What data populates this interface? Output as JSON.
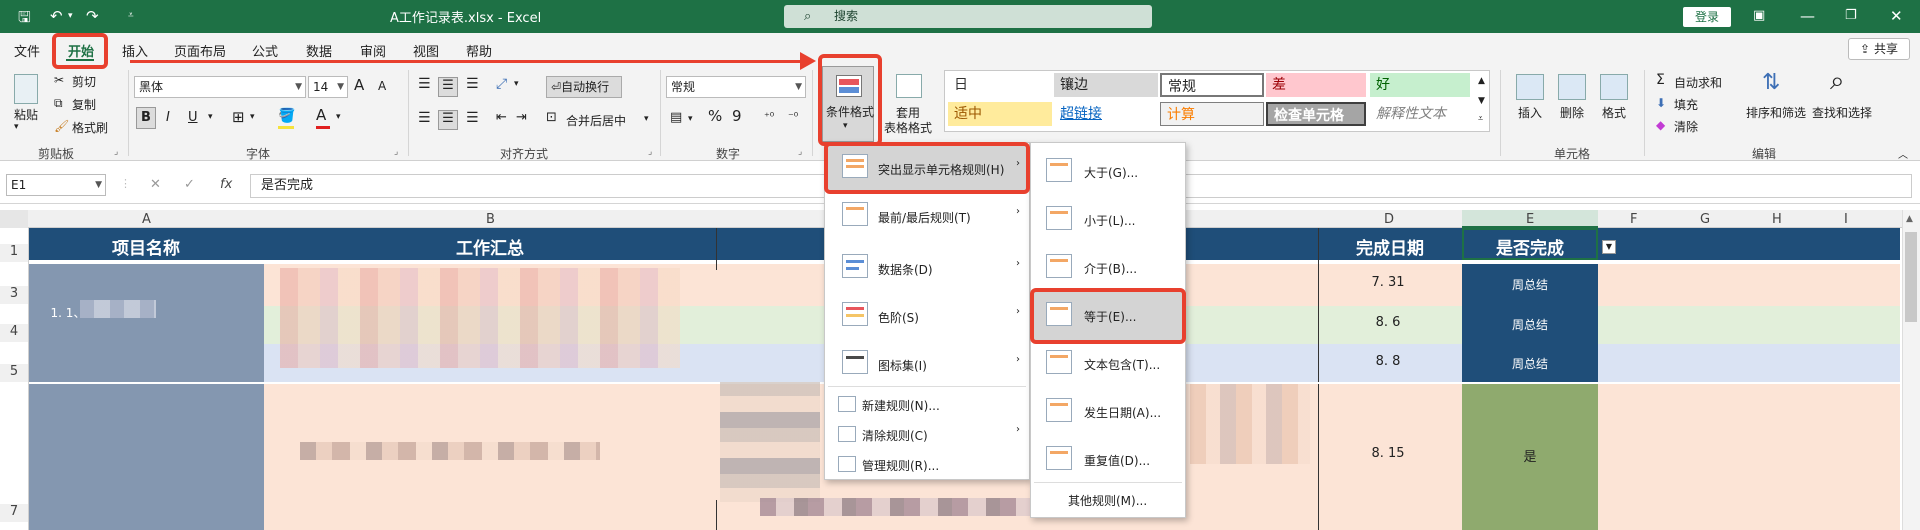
{
  "window": {
    "title": "A工作记录表.xlsx  -  Excel",
    "search_placeholder": "搜索",
    "login": "登录",
    "share": "共享"
  },
  "menu_tabs": [
    "文件",
    "开始",
    "插入",
    "页面布局",
    "公式",
    "数据",
    "审阅",
    "视图",
    "帮助"
  ],
  "clipboard": {
    "paste": "粘贴",
    "cut": "剪切",
    "copy": "复制",
    "format_painter": "格式刷",
    "label": "剪贴板"
  },
  "font": {
    "name": "黑体",
    "size": "14",
    "grow": "A",
    "shrink": "A",
    "bold": "B",
    "italic": "I",
    "underline": "U",
    "font_color": "A",
    "label": "字体"
  },
  "alignment": {
    "wrap": "自动换行",
    "merge": "合并后居中",
    "label": "对齐方式"
  },
  "number": {
    "format": "常规",
    "percent": "%",
    "comma": "9",
    "label": "数字"
  },
  "styles": {
    "cond_format": "条件格式",
    "table_format_1": "套用",
    "table_format_2": "表格格式",
    "cells": [
      "日",
      "镶边",
      "常规",
      "差",
      "好",
      "适中",
      "超链接",
      "计算",
      "检查单元格",
      "解释性文本"
    ]
  },
  "cells_group": {
    "insert": "插入",
    "delete": "删除",
    "format": "格式",
    "label": "单元格"
  },
  "editing": {
    "autosum": "自动求和",
    "fill": "填充",
    "clear": "清除",
    "sort": "排序和筛选",
    "find": "查找和选择",
    "label": "编辑"
  },
  "formula_bar": {
    "name_box": "E1",
    "cancel": "✕",
    "enter": "✓",
    "fx": "fx",
    "value": "是否完成"
  },
  "columns": [
    "A",
    "B",
    "D",
    "E",
    "F",
    "G",
    "H",
    "I"
  ],
  "rows": [
    "1",
    "3",
    "4",
    "5",
    "7"
  ],
  "headers": {
    "a": "项目名称",
    "b": "工作汇总",
    "d": "完成日期",
    "e": "是否完成"
  },
  "cells": {
    "a3": "1. 1、",
    "d3": "7. 31",
    "d4": "8. 6",
    "d5": "8. 8",
    "d6": "8. 15",
    "e3": "周总结",
    "e4": "周总结",
    "e5": "周总结",
    "e6": "是"
  },
  "cf_menu": [
    {
      "label": "突出显示单元格规则(H)"
    },
    {
      "label": "最前/最后规则(T)"
    },
    {
      "label": "数据条(D)"
    },
    {
      "label": "色阶(S)"
    },
    {
      "label": "图标集(I)"
    },
    {
      "label": "新建规则(N)..."
    },
    {
      "label": "清除规则(C)"
    },
    {
      "label": "管理规则(R)..."
    }
  ],
  "sub_menu": [
    {
      "label": "大于(G)..."
    },
    {
      "label": "小于(L)..."
    },
    {
      "label": "介于(B)..."
    },
    {
      "label": "等于(E)..."
    },
    {
      "label": "文本包含(T)..."
    },
    {
      "label": "发生日期(A)..."
    },
    {
      "label": "重复值(D)..."
    },
    {
      "label": "其他规则(M)..."
    }
  ],
  "colors": {
    "excel_green": "#1e7145",
    "header_navy": "#1f4e79",
    "highlight_red": "#e8402e",
    "row_peach": "#fce4d6",
    "row_green": "#e2efda",
    "row_blue": "#dae3f3"
  }
}
